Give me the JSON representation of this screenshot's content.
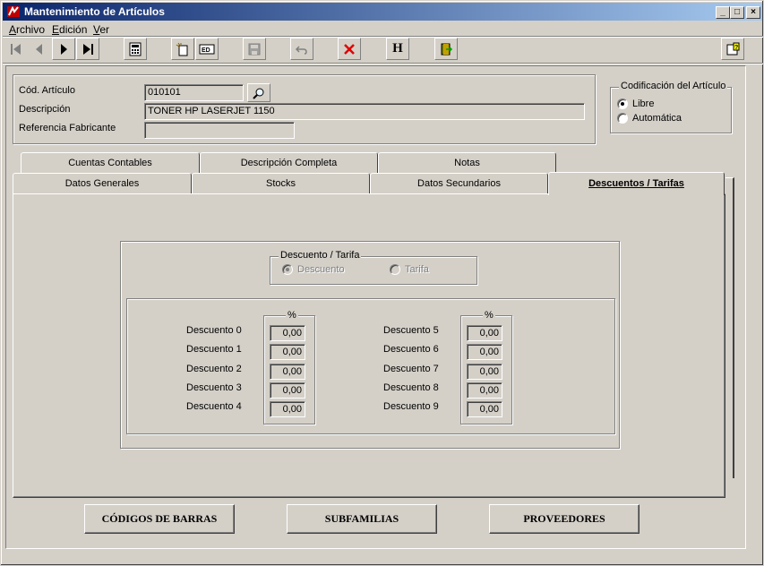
{
  "window": {
    "title": "Mantenimiento de Artículos",
    "caption_buttons": [
      "_",
      "□",
      "×"
    ]
  },
  "menu": {
    "items": [
      {
        "label": "Archivo",
        "hotkey": "A"
      },
      {
        "label": "Edición",
        "hotkey": "E"
      },
      {
        "label": "Ver",
        "hotkey": "V"
      }
    ]
  },
  "toolbar": {
    "buttons": [
      {
        "name": "first-record-icon"
      },
      {
        "name": "previous-record-icon"
      },
      {
        "name": "next-record-icon"
      },
      {
        "name": "last-record-icon"
      },
      {
        "name": "calculator-icon"
      },
      {
        "name": "new-record-icon"
      },
      {
        "name": "edit-record-icon"
      },
      {
        "name": "save-icon"
      },
      {
        "name": "undo-icon"
      },
      {
        "name": "delete-icon"
      },
      {
        "name": "history-icon",
        "text": "H"
      },
      {
        "name": "exit-icon"
      },
      {
        "name": "help-icon"
      }
    ]
  },
  "header": {
    "codigo_label": "Cód. Artículo",
    "codigo_value": "010101",
    "descripcion_label": "Descripción",
    "descripcion_value": "TONER HP LASERJET 1150",
    "referencia_label": "Referencia Fabricante",
    "referencia_value": ""
  },
  "codificacion": {
    "title": "Codificación del Artículo",
    "options": [
      "Libre",
      "Automática"
    ],
    "selected": "Libre"
  },
  "tabs": {
    "row_back": [
      "Cuentas Contables",
      "Descripción Completa",
      "Notas"
    ],
    "row_front": [
      "Datos Generales",
      "Stocks",
      "Datos Secundarios",
      "Descuentos / Tarifas"
    ],
    "active": "Descuentos / Tarifas"
  },
  "descuentos": {
    "tipo_title": "Descuento / Tarifa",
    "tipo_options": [
      "Descuento",
      "Tarifa"
    ],
    "tipo_selected": "Descuento",
    "percent_header": "%",
    "left": [
      {
        "label": "Descuento 0",
        "value": "0,00"
      },
      {
        "label": "Descuento 1",
        "value": "0,00"
      },
      {
        "label": "Descuento 2",
        "value": "0,00"
      },
      {
        "label": "Descuento 3",
        "value": "0,00"
      },
      {
        "label": "Descuento 4",
        "value": "0,00"
      }
    ],
    "right": [
      {
        "label": "Descuento 5",
        "value": "0,00"
      },
      {
        "label": "Descuento 6",
        "value": "0,00"
      },
      {
        "label": "Descuento 7",
        "value": "0,00"
      },
      {
        "label": "Descuento 8",
        "value": "0,00"
      },
      {
        "label": "Descuento 9",
        "value": "0,00"
      }
    ]
  },
  "bottom_buttons": {
    "codigos": "CÓDIGOS DE BARRAS",
    "subfamilias": "SUBFAMILIAS",
    "proveedores": "PROVEEDORES"
  }
}
